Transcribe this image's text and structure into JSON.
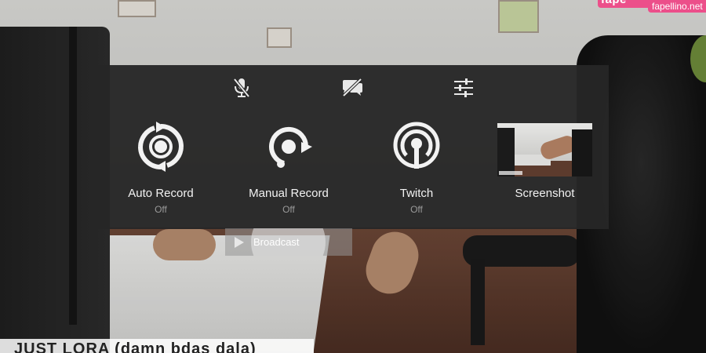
{
  "watermark": {
    "brand": "fape",
    "site": "fapellino.net"
  },
  "toolbar": {
    "mic_icon": "mic-off-icon",
    "chat_icon": "chat-off-icon",
    "settings_icon": "sliders-icon"
  },
  "tiles": [
    {
      "label": "Auto Record",
      "state": "Off",
      "icon": "auto-record-icon"
    },
    {
      "label": "Manual Record",
      "state": "Off",
      "icon": "manual-record-icon"
    },
    {
      "label": "Twitch",
      "state": "Off",
      "icon": "twitch-broadcast-icon"
    }
  ],
  "screenshot": {
    "label": "Screenshot"
  },
  "broadcast": {
    "label": "Broadcast",
    "icon": "play-icon"
  },
  "caption": {
    "text": "JUST LORA (damn bdas dala)"
  },
  "colors": {
    "panel": "#262626",
    "text": "#f2f2f2",
    "muted": "#9a9a9a",
    "accent": "#ec4f8a"
  }
}
